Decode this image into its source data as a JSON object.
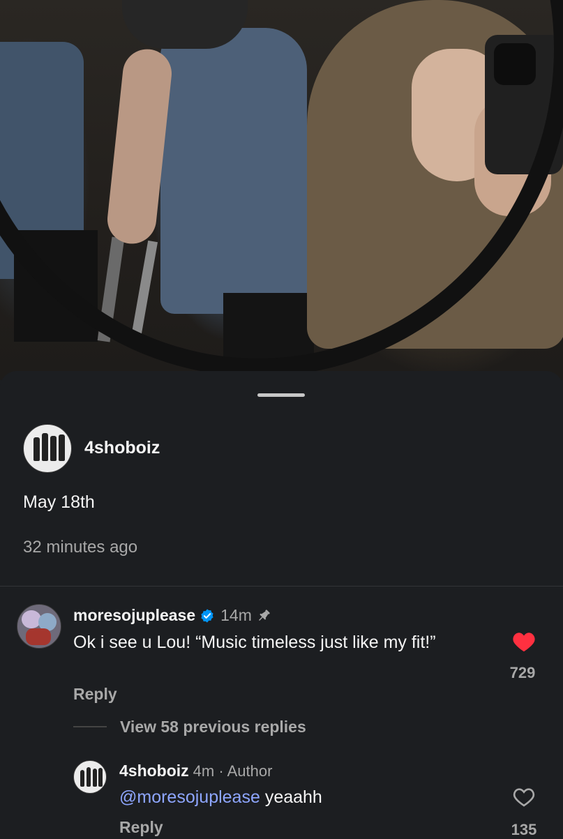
{
  "post": {
    "username": "4shoboiz",
    "caption": "May 18th",
    "time_ago": "32 minutes ago"
  },
  "comment": {
    "username": "moresojuplease",
    "time": "14m",
    "text": "Ok i see u Lou! “Music timeless just like my fit!”",
    "reply_label": "Reply",
    "likes": "729",
    "liked": true,
    "verified": true,
    "pinned": true,
    "view_replies": "View 58 previous replies"
  },
  "reply": {
    "username": "4shoboiz",
    "meta": "4m · Author",
    "mention": "@moresojuplease",
    "text": " yeaahh",
    "reply_label": "Reply",
    "likes": "135",
    "liked": false
  },
  "colors": {
    "background": "#1c1e21",
    "like_red": "#ff3040",
    "verified_blue": "#0095f6",
    "mention_blue": "#8ea6ff",
    "secondary_text": "#a8a8a8"
  },
  "icons": [
    "verified-icon",
    "pin-icon",
    "heart-filled-icon",
    "heart-outline-icon"
  ]
}
